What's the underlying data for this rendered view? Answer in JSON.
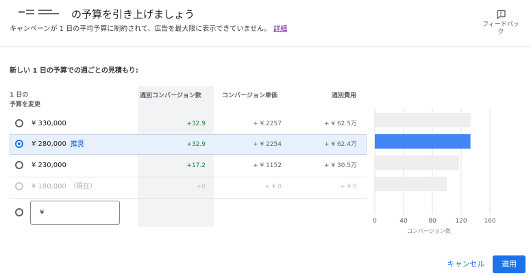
{
  "header": {
    "title": "の予算を引き上げましょう",
    "subtitle": "キャンペーンが 1 日の平均予算に制約されて、広告を最大限に表示できていません。",
    "details_link": "詳細",
    "feedback_label": "フィードバック"
  },
  "section_title": "新しい 1 日の予算での週ごとの見積もり:",
  "table": {
    "col_budget_line1": "1 日の",
    "col_budget_line2": "予算を変更",
    "col_conversions": "週別コンバージョン数",
    "col_cost_per_conversion": "コンバージョン単価",
    "col_weekly_cost": "週別費用",
    "rows": [
      {
        "amount": "¥ 330,000",
        "tag": "",
        "conversions": "+32.9",
        "cost_per_conversion": "+ ¥ 2257",
        "weekly_cost": "+ ¥ 62.5万"
      },
      {
        "amount": "¥ 280,000",
        "tag": "推奨",
        "conversions": "+32.9",
        "cost_per_conversion": "+ ¥ 2254",
        "weekly_cost": "+ ¥ 62.4万"
      },
      {
        "amount": "¥ 230,000",
        "tag": "",
        "conversions": "+17.2",
        "cost_per_conversion": "+ ¥ 1152",
        "weekly_cost": "+ ¥ 30.5万"
      },
      {
        "amount": "¥ 180,000",
        "tag": "（現在）",
        "conversions": "+0",
        "cost_per_conversion": "+ ¥ 0",
        "weekly_cost": "+ ¥ 0"
      }
    ],
    "custom_currency": "¥"
  },
  "chart_data": {
    "type": "bar",
    "orientation": "horizontal",
    "categories": [
      "¥ 330,000",
      "¥ 280,000",
      "¥ 230,000",
      "¥ 180,000"
    ],
    "values": [
      133,
      133,
      117,
      100
    ],
    "highlight_index": 1,
    "xlabel": "コンバージョン数",
    "xlim": [
      0,
      160
    ],
    "xticks": [
      "0",
      "40",
      "80",
      "120",
      "160"
    ],
    "grid": true,
    "colors": {
      "bar": "#eeeeee",
      "highlight": "#4285f4",
      "grid": "#e0e0e0"
    }
  },
  "footer": {
    "cancel_label": "キャンセル",
    "apply_label": "適用"
  },
  "colors": {
    "accent": "#1a73e8",
    "positive": "#188038",
    "selected_row": "#e8f0fe"
  }
}
